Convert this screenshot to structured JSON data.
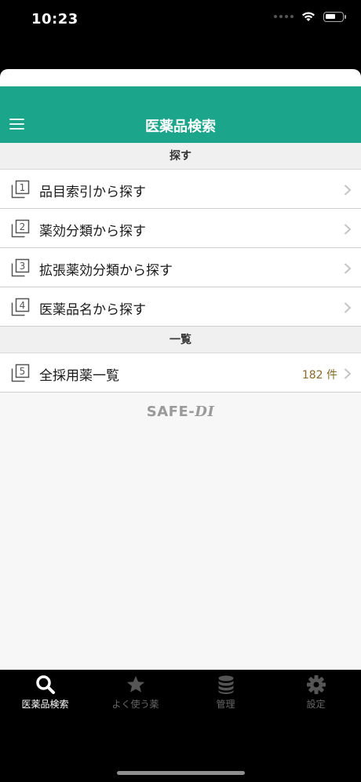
{
  "status_bar": {
    "time": "10:23"
  },
  "header": {
    "title": "医薬品検索",
    "menu_icon": "hamburger-menu-icon"
  },
  "sections": [
    {
      "title": "探す",
      "items": [
        {
          "number": "1",
          "label": "品目索引から探す"
        },
        {
          "number": "2",
          "label": "薬効分類から探す"
        },
        {
          "number": "3",
          "label": "拡張薬効分類から探す"
        },
        {
          "number": "4",
          "label": "医薬品名から探す"
        }
      ]
    },
    {
      "title": "一覧",
      "items": [
        {
          "number": "5",
          "label": "全採用薬一覧",
          "count": "182 件"
        }
      ]
    }
  ],
  "logo": {
    "main": "SAFE-",
    "accent": "DI"
  },
  "tabs": [
    {
      "label": "医薬品検索",
      "icon": "search-icon",
      "active": true
    },
    {
      "label": "よく使う薬",
      "icon": "star-icon",
      "active": false
    },
    {
      "label": "管理",
      "icon": "database-icon",
      "active": false
    },
    {
      "label": "設定",
      "icon": "gear-icon",
      "active": false
    }
  ],
  "colors": {
    "header": "#1ba58a",
    "count_text": "#8b6a25",
    "tab_active": "#ffffff",
    "tab_inactive": "#666666"
  }
}
